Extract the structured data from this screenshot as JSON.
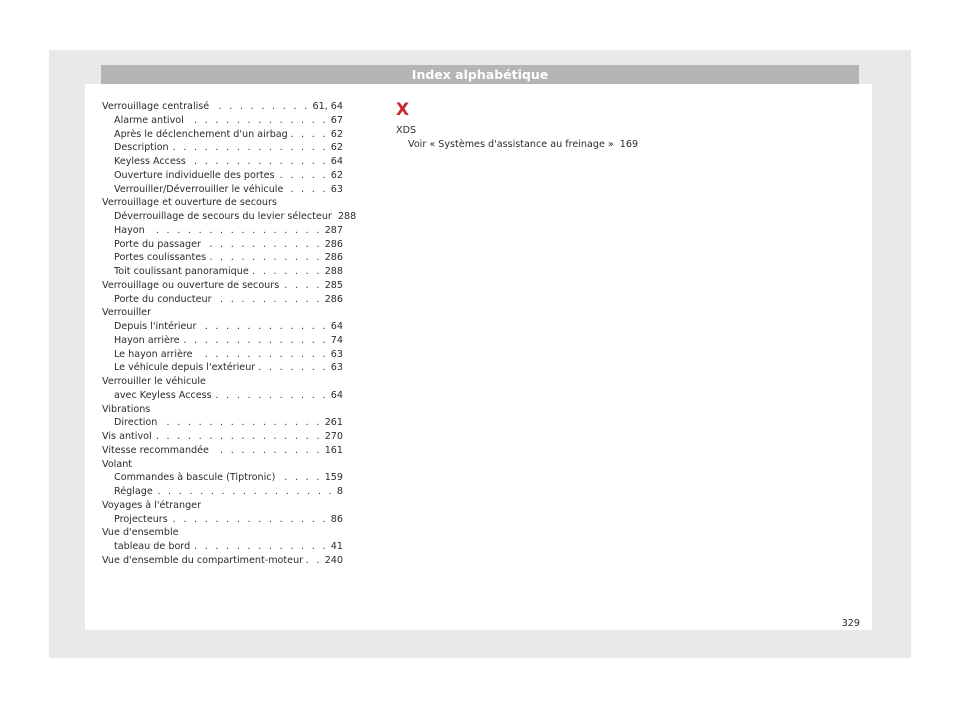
{
  "header": {
    "title": "Index alphabétique"
  },
  "left_entries": [
    {
      "text": "Verrouillage centralisé",
      "page": "61, 64",
      "level": 0
    },
    {
      "text": "Alarme antivol",
      "page": "67",
      "level": 1
    },
    {
      "text": "Après le déclenchement d'un airbag",
      "page": "62",
      "level": 1
    },
    {
      "text": "Description",
      "page": "62",
      "level": 1
    },
    {
      "text": "Keyless Access",
      "page": "64",
      "level": 1
    },
    {
      "text": "Ouverture individuelle des portes",
      "page": "62",
      "level": 1
    },
    {
      "text": "Verrouiller/Déverrouiller le véhicule",
      "page": "63",
      "level": 1
    },
    {
      "text": "Verrouillage et ouverture de secours",
      "page": "",
      "level": 0
    },
    {
      "text": "Déverrouillage de secours du levier sélecteur",
      "page": "288",
      "level": 1
    },
    {
      "text": "Hayon",
      "page": "287",
      "level": 1
    },
    {
      "text": "Porte du passager",
      "page": "286",
      "level": 1
    },
    {
      "text": "Portes coulissantes",
      "page": "286",
      "level": 1
    },
    {
      "text": "Toit coulissant panoramique",
      "page": "288",
      "level": 1
    },
    {
      "text": "Verrouillage ou ouverture de secours",
      "page": "285",
      "level": 0
    },
    {
      "text": "Porte du conducteur",
      "page": "286",
      "level": 1
    },
    {
      "text": "Verrouiller",
      "page": "",
      "level": 0
    },
    {
      "text": "Depuis l'intérieur",
      "page": "64",
      "level": 1
    },
    {
      "text": "Hayon arrière",
      "page": "74",
      "level": 1
    },
    {
      "text": "Le hayon arrière",
      "page": "63",
      "level": 1
    },
    {
      "text": "Le véhicule depuis l'extérieur",
      "page": "63",
      "level": 1
    },
    {
      "text": "Verrouiller le véhicule",
      "page": "",
      "level": 0
    },
    {
      "text": "avec Keyless Access",
      "page": "64",
      "level": 1
    },
    {
      "text": "Vibrations",
      "page": "",
      "level": 0
    },
    {
      "text": "Direction",
      "page": "261",
      "level": 1
    },
    {
      "text": "Vis antivol",
      "page": "270",
      "level": 0
    },
    {
      "text": "Vitesse recommandée",
      "page": "161",
      "level": 0
    },
    {
      "text": "Volant",
      "page": "",
      "level": 0
    },
    {
      "text": "Commandes à bascule (Tiptronic)",
      "page": "159",
      "level": 1
    },
    {
      "text": "Réglage",
      "page": "8",
      "level": 1
    },
    {
      "text": "Voyages à l'étranger",
      "page": "",
      "level": 0
    },
    {
      "text": "Projecteurs",
      "page": "86",
      "level": 1
    },
    {
      "text": "Vue d'ensemble",
      "page": "",
      "level": 0
    },
    {
      "text": "tableau de bord",
      "page": "41",
      "level": 1
    },
    {
      "text": "Vue d'ensemble du compartiment-moteur",
      "page": "240",
      "level": 0
    }
  ],
  "section_letter": "X",
  "mid_entries": [
    {
      "text": "XDS",
      "page": "",
      "level": 0
    },
    {
      "text": "Voir « Systèmes d'assistance au freinage »",
      "page": "169",
      "level": 1
    }
  ],
  "page_number": "329"
}
